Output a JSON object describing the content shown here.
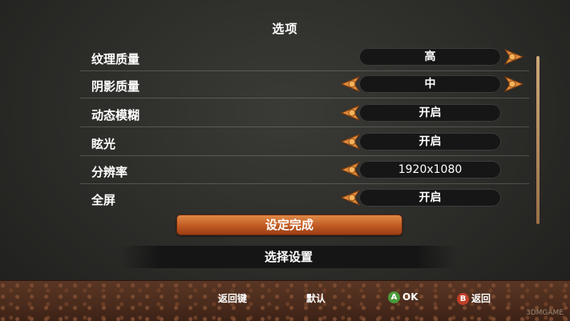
{
  "title": "选项",
  "rows": [
    {
      "label": "纹理质量",
      "value": "高",
      "left_arrow": false,
      "right_arrow": true
    },
    {
      "label": "阴影质量",
      "value": "中",
      "left_arrow": true,
      "right_arrow": true
    },
    {
      "label": "动态模糊",
      "value": "开启",
      "left_arrow": true,
      "right_arrow": false
    },
    {
      "label": "眩光",
      "value": "开启",
      "left_arrow": true,
      "right_arrow": false
    },
    {
      "label": "分辨率",
      "value": "1920x1080",
      "left_arrow": true,
      "right_arrow": false
    },
    {
      "label": "全屏",
      "value": "开启",
      "left_arrow": true,
      "right_arrow": false
    }
  ],
  "done_button": "设定完成",
  "select_settings": "选择设置",
  "footer": {
    "back_key": "返回键",
    "default": "默认",
    "a_label": "A",
    "ok": "OK",
    "b_label": "B",
    "back": "返回"
  },
  "watermark": "3DMGAME",
  "colors": {
    "accent_orange": "#d9782f",
    "button_a": "#4c9a3c",
    "button_b": "#c0402a",
    "footer_brown": "#4a2b1c"
  }
}
